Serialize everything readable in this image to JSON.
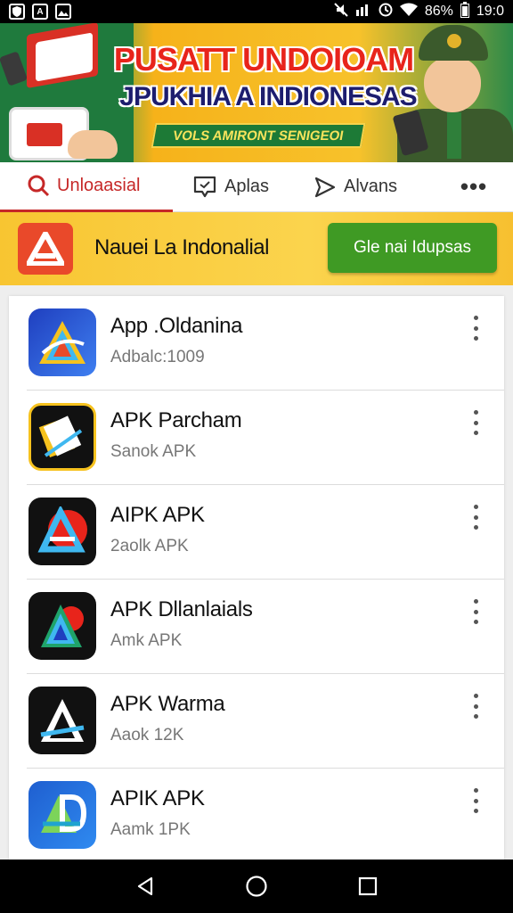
{
  "status_bar": {
    "battery": "86%",
    "time": "19:0",
    "icons": [
      "shield-icon",
      "a-icon",
      "image-icon",
      "mute-icon",
      "data-icon",
      "clock-icon",
      "wifi-icon",
      "battery-icon"
    ]
  },
  "banner": {
    "title_line1": "PUSATT UNDOIOAM",
    "title_line2": "JPUKHIA A INDIONESAS",
    "ribbon": "VOLS AMIRONT SENIGEOI"
  },
  "tabs": [
    {
      "label": "Unloaasial",
      "icon": "search-icon",
      "active": true
    },
    {
      "label": "Aplas",
      "icon": "chat-icon",
      "active": false
    },
    {
      "label": "Alvans",
      "icon": "send-icon",
      "active": false
    },
    {
      "label": "•••",
      "icon": "more-icon",
      "active": false
    }
  ],
  "promo": {
    "title": "Nauei La Indonalial",
    "button": "Gle nai Idupsas",
    "icon": "app-logo-icon"
  },
  "apps": [
    {
      "name": "App .Oldanina",
      "sub": "Adbalc:1009",
      "icon": "app-icon-blue-a"
    },
    {
      "name": "APK Parcham",
      "sub": "Sanok APK",
      "icon": "app-icon-yellow-stack"
    },
    {
      "name": "AIPK APK",
      "sub": "2aolk APK",
      "icon": "app-icon-red-a"
    },
    {
      "name": "APK Dllanlaials",
      "sub": "Amk APK",
      "icon": "app-icon-teal-a"
    },
    {
      "name": "APK Warma",
      "sub": "Aaok 12K",
      "icon": "app-icon-white-a"
    },
    {
      "name": "APIK APK",
      "sub": "Aamk 1PK",
      "icon": "app-icon-blue-square"
    }
  ],
  "colors": {
    "accent_red": "#c62828",
    "promo_yellow": "#fbd44d",
    "button_green": "#3f9a24"
  }
}
